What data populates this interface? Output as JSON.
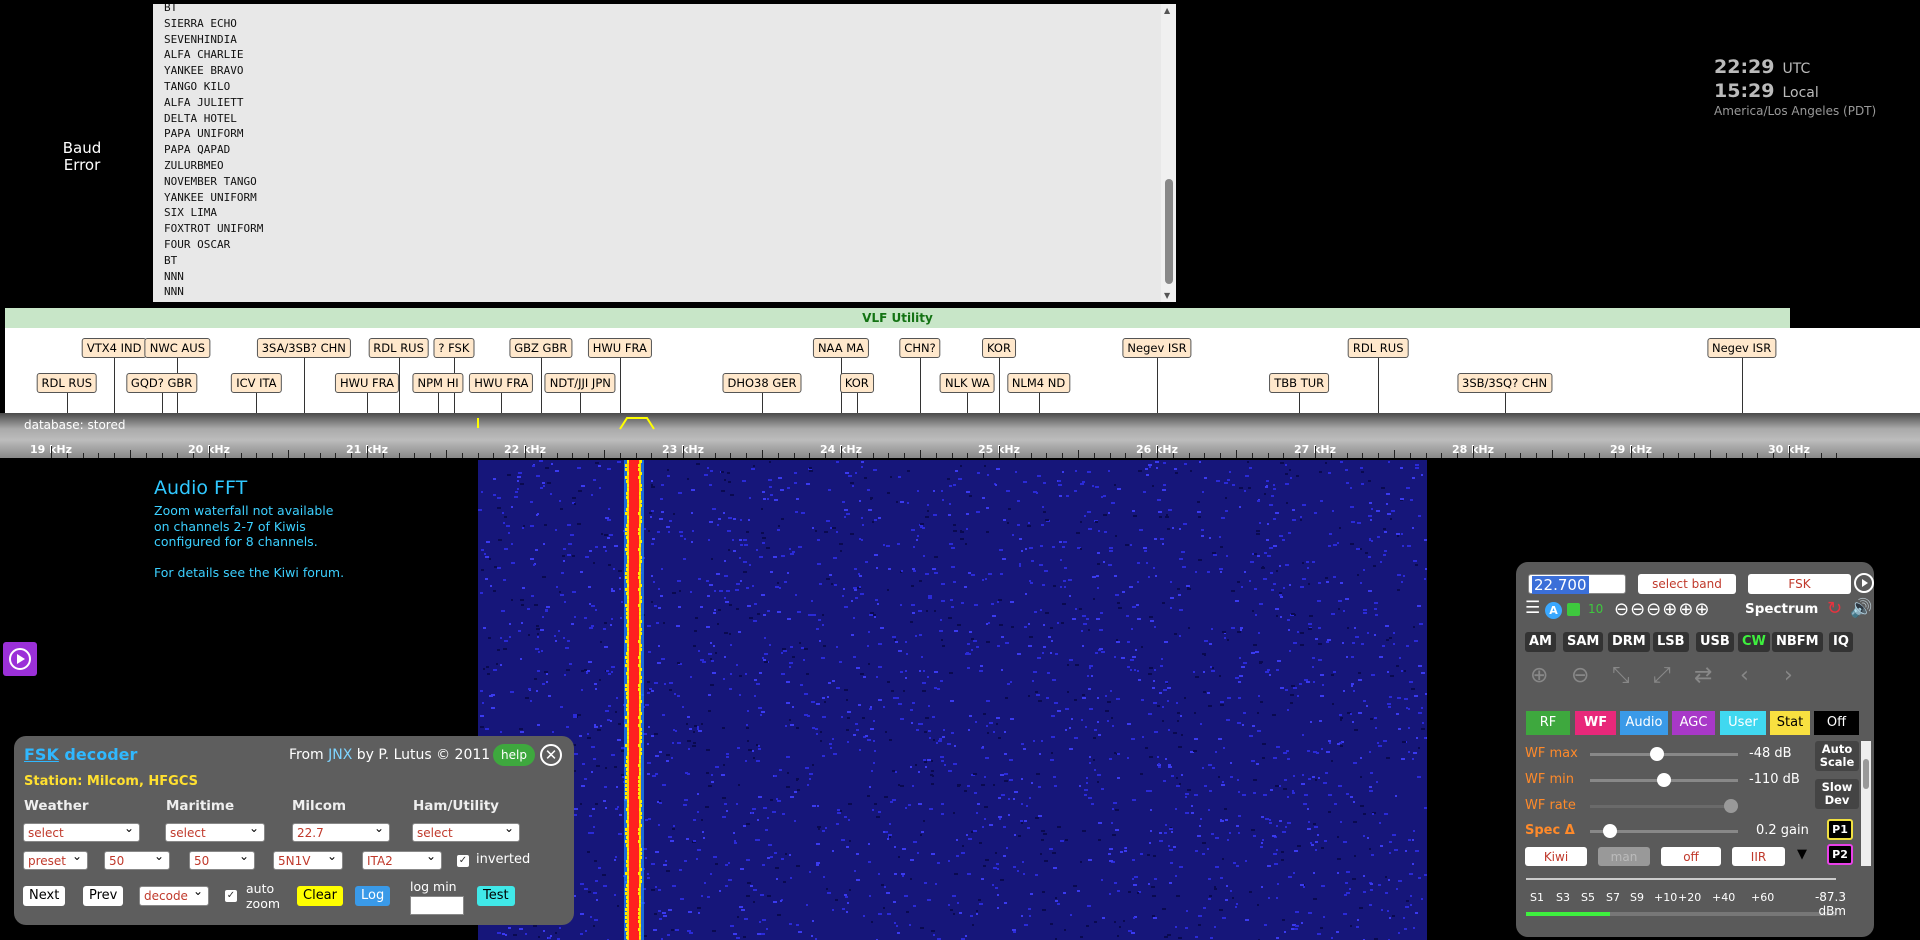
{
  "console": {
    "baud_label": "Baud\nError",
    "lines": [
      "BT",
      "SIERRA ECHO",
      "SEVENHINDIA",
      "ALFA CHARLIE",
      "YANKEE BRAVO",
      "TANGO KILO",
      "ALFA JULIETT",
      "DELTA HOTEL",
      "PAPA UNIFORM",
      "PAPA QAPAD",
      "ZULURBMEO",
      "NOVEMBER TANGO",
      "YANKEE UNIFORM",
      "SIX LIMA",
      "FOXTROT UNIFORM",
      "FOUR OSCAR",
      "BT",
      "NNN",
      "NNN"
    ]
  },
  "clock": {
    "utc_time": "22:29",
    "utc_label": "UTC",
    "local_time": "15:29",
    "local_label": "Local",
    "timezone": "America/Los Angeles (PDT)"
  },
  "band": {
    "name": "VLF Utility"
  },
  "stations_top": [
    {
      "label": "VTX4 IND",
      "khz": 19.4
    },
    {
      "label": "NWC AUS",
      "khz": 19.8
    },
    {
      "label": "3SA/3SB? CHN",
      "khz": 20.6
    },
    {
      "label": "RDL RUS",
      "khz": 21.2
    },
    {
      "label": "? FSK",
      "khz": 21.55
    },
    {
      "label": "GBZ GBR",
      "khz": 22.1
    },
    {
      "label": "HWU FRA",
      "khz": 22.6
    },
    {
      "label": "NAA MA",
      "khz": 24.0
    },
    {
      "label": "CHN?",
      "khz": 24.5
    },
    {
      "label": "KOR",
      "khz": 25.0
    },
    {
      "label": "Negev ISR",
      "khz": 26.0
    },
    {
      "label": "RDL RUS",
      "khz": 27.4
    },
    {
      "label": "Negev ISR",
      "khz": 29.7
    }
  ],
  "stations_bottom": [
    {
      "label": "RDL RUS",
      "khz": 19.1
    },
    {
      "label": "GQD? GBR",
      "khz": 19.7
    },
    {
      "label": "ICV ITA",
      "khz": 20.3
    },
    {
      "label": "HWU FRA",
      "khz": 21.0
    },
    {
      "label": "NPM HI",
      "khz": 21.45
    },
    {
      "label": "HWU FRA",
      "khz": 21.85
    },
    {
      "label": "NDT/JJI JPN",
      "khz": 22.35
    },
    {
      "label": "DHO38 GER",
      "khz": 23.5
    },
    {
      "label": "KOR",
      "khz": 24.1
    },
    {
      "label": "NLK WA",
      "khz": 24.8
    },
    {
      "label": "NLM4 ND",
      "khz": 25.25
    },
    {
      "label": "TBB TUR",
      "khz": 26.9
    },
    {
      "label": "3SB/3SQ? CHN",
      "khz": 28.2
    }
  ],
  "scale": {
    "db_status": "database: stored",
    "ticks": [
      "19 kHz",
      "20 kHz",
      "21 kHz",
      "22 kHz",
      "23 kHz",
      "24 kHz",
      "25 kHz",
      "26 kHz",
      "27 kHz",
      "28 kHz",
      "29 kHz",
      "30 kHz"
    ]
  },
  "audio_fft": {
    "title": "Audio FFT",
    "body": [
      "Zoom waterfall not available",
      "on channels 2-7 of Kiwis",
      "configured for 8 channels."
    ],
    "footer": "For details see the Kiwi forum."
  },
  "fsk": {
    "title_link": "FSK",
    "title_rest": " decoder",
    "from_prefix": "From ",
    "from_link": "JNX",
    "from_suffix": " by P. Lutus © 2011",
    "help": "help",
    "station": "Station: Milcom, HFGCS",
    "headers": [
      "Weather",
      "Maritime",
      "Milcom",
      "Ham/Utility"
    ],
    "row1": [
      "select",
      "select",
      "22.7",
      "select"
    ],
    "row2": [
      "preset",
      "50",
      "50",
      "5N1V",
      "ITA2"
    ],
    "inverted": "inverted",
    "next": "Next",
    "prev": "Prev",
    "decode": "decode",
    "auto_zoom": "auto\nzoom",
    "clear": "Clear",
    "log": "Log",
    "log_min": "log min",
    "test": "Test"
  },
  "control": {
    "freq": "22.700",
    "band_select": "select band",
    "mode_select": "FSK",
    "spectrum": "Spectrum",
    "n_ten": "10",
    "modes": [
      "AM",
      "SAM",
      "DRM",
      "LSB",
      "USB",
      "CW",
      "NBFM",
      "IQ"
    ],
    "tabs": [
      "RF",
      "WF",
      "Audio",
      "AGC",
      "User",
      "Stat",
      "Off"
    ],
    "wf_max_label": "WF max",
    "wf_max_val": "-48 dB",
    "wf_max_frac": 0.45,
    "wf_min_label": "WF min",
    "wf_min_val": "-110 dB",
    "wf_min_frac": 0.5,
    "wf_rate_label": "WF rate",
    "wf_rate_frac": 1.0,
    "spec_label": "Spec Δ",
    "spec_val": "0.2 gain",
    "spec_frac": 0.1,
    "auto_scale": "Auto\nScale",
    "slow_dev": "Slow\nDev",
    "p1": "P1",
    "p2": "P2",
    "row_selects": [
      "Kiwi",
      "man",
      "off",
      "IIR"
    ],
    "smeter_labels": [
      "S1",
      "S3",
      "S5",
      "S7",
      "S9",
      "+10",
      "+20",
      "+40",
      "+60"
    ],
    "smeter_reading": "-87.3",
    "smeter_unit": "dBm",
    "smeter_frac": 0.27
  },
  "colors": {
    "accent_blue": "#30b8ff",
    "band_green": "#c8e6c8",
    "station_tag": "#ffe8cc",
    "waterfall_signal": "#ff2020"
  }
}
